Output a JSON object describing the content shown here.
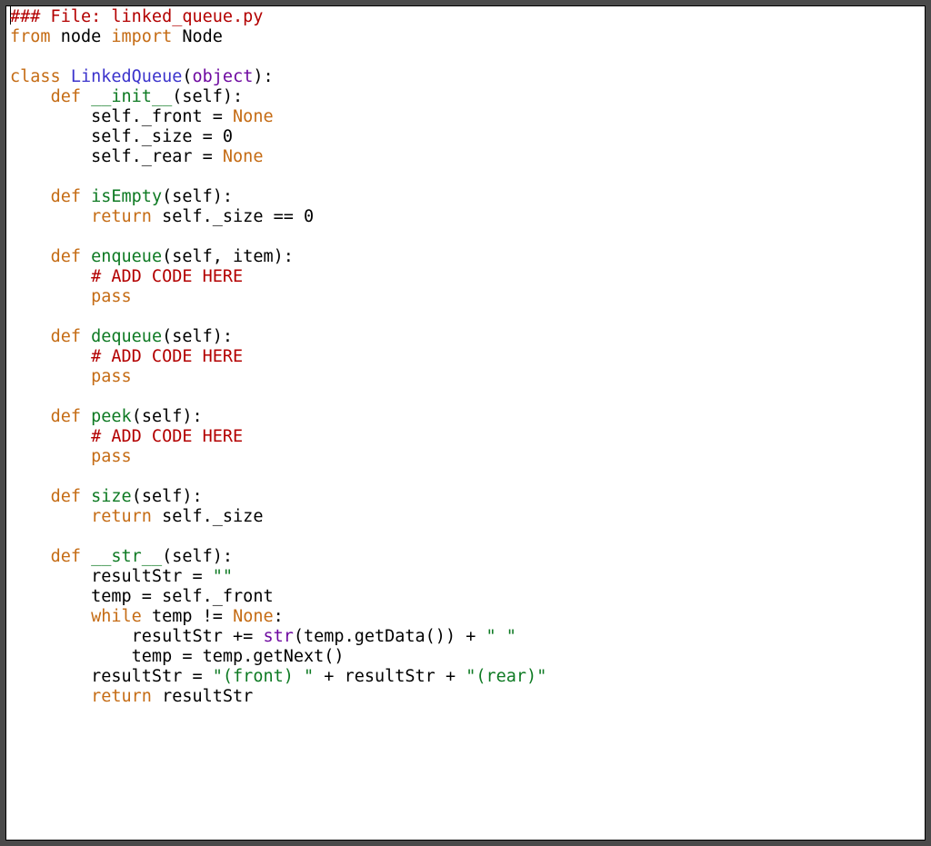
{
  "colors": {
    "keyword": "#c56c15",
    "class_name": "#3b33cc",
    "function_name": "#0e7a23",
    "builtin": "#6e0aa0",
    "string": "#0e7a23",
    "comment": "#b30000",
    "text": "#000000",
    "background": "#ffffff",
    "outer_bg": "#4a4a4a"
  },
  "header": {
    "comment_line": "### File: linked_queue.py"
  },
  "imports": {
    "from_kw": "from",
    "module": " node ",
    "import_kw": "import",
    "name": " Node"
  },
  "class_decl": {
    "class_kw": "class",
    "sp1": " ",
    "name": "LinkedQueue",
    "open": "(",
    "base": "object",
    "close": "):"
  },
  "indent": {
    "l1": "    ",
    "l2": "        ",
    "l3": "            "
  },
  "methods": {
    "init": {
      "def_kw": "def",
      "name": " __init__",
      "sig": "(self):",
      "b1a": "self._front = ",
      "b1b": "None",
      "b2": "self._size = 0",
      "b3a": "self._rear = ",
      "b3b": "None"
    },
    "isEmpty": {
      "def_kw": "def",
      "name": " isEmpty",
      "sig": "(self):",
      "ret_kw": "return",
      "ret_expr": " self._size == 0"
    },
    "enqueue": {
      "def_kw": "def",
      "name": " enqueue",
      "sig": "(self, item):",
      "comment": "# ADD CODE HERE",
      "pass_kw": "pass"
    },
    "dequeue": {
      "def_kw": "def",
      "name": " dequeue",
      "sig": "(self):",
      "comment": "# ADD CODE HERE",
      "pass_kw": "pass"
    },
    "peek": {
      "def_kw": "def",
      "name": " peek",
      "sig": "(self):",
      "comment": "# ADD CODE HERE",
      "pass_kw": "pass"
    },
    "size": {
      "def_kw": "def",
      "name": " size",
      "sig": "(self):",
      "ret_kw": "return",
      "ret_expr": " self._size"
    },
    "str": {
      "def_kw": "def",
      "name": " __str__",
      "sig": "(self):",
      "l1a": "resultStr = ",
      "l1b": "\"\"",
      "l2": "temp = self._front",
      "while_kw": "while",
      "while_cond_a": " temp != ",
      "while_cond_b": "None",
      "while_cond_c": ":",
      "wl1a": "resultStr += ",
      "wl1b": "str",
      "wl1c": "(temp.getData()) + ",
      "wl1d": "\" \"",
      "wl2": "temp = temp.getNext()",
      "l5a": "resultStr = ",
      "l5b": "\"(front) \"",
      "l5c": " + resultStr + ",
      "l5d": "\"(rear)\"",
      "ret_kw": "return",
      "ret_expr": " resultStr"
    }
  }
}
